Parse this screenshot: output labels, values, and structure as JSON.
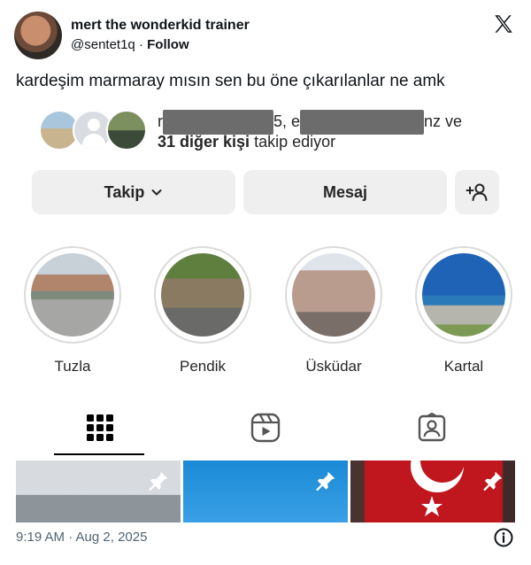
{
  "tweet": {
    "author_name": "mert the wonderkid trainer",
    "handle": "@sentet1q",
    "separator": "·",
    "follow_label": "Follow",
    "text": "kardeşim marmaray mısın sen bu öne çıkarılanlar ne amk",
    "timestamp": "9:19 AM · Aug 2, 2025"
  },
  "profile": {
    "followed_by_prefix": "r",
    "followed_by_mid": "5, e",
    "followed_by_suffix": "nz ve",
    "followed_by_count": "31 diğer kişi",
    "followed_by_tail": "takip ediyor",
    "buttons": {
      "follow": "Takip",
      "message": "Mesaj"
    },
    "highlights": [
      {
        "label": "Tuzla"
      },
      {
        "label": "Pendik"
      },
      {
        "label": "Üsküdar"
      },
      {
        "label": "Kartal"
      }
    ]
  },
  "icons": [
    "x-logo-icon",
    "chevron-down-icon",
    "add-person-icon",
    "grid-icon",
    "reels-icon",
    "tagged-icon",
    "pin-icon",
    "info-icon"
  ]
}
